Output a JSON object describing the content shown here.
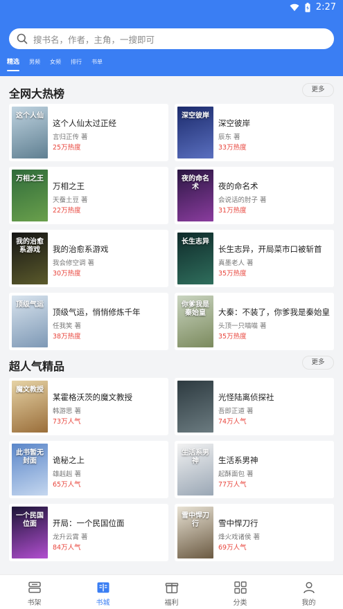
{
  "statusbar": {
    "time": "2:27",
    "icons": [
      "wifi-icon",
      "battery-charging-icon"
    ]
  },
  "search": {
    "placeholder": "搜书名，作者，主角，一搜即可"
  },
  "tabs": [
    {
      "label": "精选",
      "active": true
    },
    {
      "label": "男频"
    },
    {
      "label": "女频"
    },
    {
      "label": "排行"
    },
    {
      "label": "书单"
    }
  ],
  "sections": [
    {
      "title": "全网大热榜",
      "more": "更多",
      "books": [
        {
          "title": "这个人仙太过正经",
          "author": "言归正传 著",
          "stat": "25万热度",
          "cover_text": "这个人仙",
          "cover_colors": [
            "#bfd3e0",
            "#5f7f91"
          ]
        },
        {
          "title": "深空彼岸",
          "author": "辰东 著",
          "stat": "33万热度",
          "cover_text": "深空彼岸",
          "cover_colors": [
            "#1b2a6b",
            "#5a6fbf"
          ]
        },
        {
          "title": "万相之王",
          "author": "天蚕土豆 著",
          "stat": "22万热度",
          "cover_text": "万相之王",
          "cover_colors": [
            "#2f6b3a",
            "#6aa04c"
          ]
        },
        {
          "title": "夜的命名术",
          "author": "会说话的肘子 著",
          "stat": "31万热度",
          "cover_text": "夜的命名术",
          "cover_colors": [
            "#2a1642",
            "#8a3c9e"
          ]
        },
        {
          "title": "我的治愈系游戏",
          "author": "我会修空调 著",
          "stat": "30万热度",
          "cover_text": "我的治愈系游戏",
          "cover_colors": [
            "#151515",
            "#5b5a2b"
          ]
        },
        {
          "title": "长生志异，开局菜市口被斩首",
          "author": "真墨老人 著",
          "stat": "35万热度",
          "cover_text": "长生志异",
          "cover_colors": [
            "#0f2a2a",
            "#2f6e5c"
          ]
        },
        {
          "title": "顶级气运，悄悄修炼千年",
          "author": "任我笑 著",
          "stat": "38万热度",
          "cover_text": "顶级气运",
          "cover_colors": [
            "#d9e4ee",
            "#7d98b5"
          ]
        },
        {
          "title": "大秦：不装了，你爹我是秦始皇",
          "author": "头顶一只喵喵 著",
          "stat": "35万热度",
          "cover_text": "你爹我是秦始皇",
          "cover_colors": [
            "#c9d4c0",
            "#7b8a5d"
          ]
        }
      ]
    },
    {
      "title": "超人气精品",
      "more": "更多",
      "books": [
        {
          "title": "某霍格沃茨的魔文教授",
          "author": "韩游思 著",
          "stat": "73万人气",
          "cover_text": "魔文教授",
          "cover_colors": [
            "#e6d3a6",
            "#9a6e3a"
          ]
        },
        {
          "title": "光怪陆离侦探社",
          "author": "吾即正道 著",
          "stat": "74万人气",
          "cover_text": "",
          "cover_colors": [
            "#2d3a40",
            "#6b7b80"
          ]
        },
        {
          "title": "诡秘之上",
          "author": "雄赳赳 著",
          "stat": "65万人气",
          "cover_text": "此书暂无封面",
          "cover_colors": [
            "#5a86c9",
            "#c5d7ef"
          ]
        },
        {
          "title": "生活系男神",
          "author": "起酥面包 著",
          "stat": "77万人气",
          "cover_text": "生活系男神",
          "cover_colors": [
            "#f2f2f2",
            "#9aa7b5"
          ]
        },
        {
          "title": "开局：一个民国位面",
          "author": "龙升云霄 著",
          "stat": "84万人气",
          "cover_text": "一个民国位面",
          "cover_colors": [
            "#1b1436",
            "#b24fd0"
          ]
        },
        {
          "title": "雪中悍刀行",
          "author": "烽火戏诸侯 著",
          "stat": "69万人气",
          "cover_text": "雪中悍刀行",
          "cover_colors": [
            "#e8e2d4",
            "#6b5a42"
          ]
        }
      ]
    }
  ],
  "bottom_nav": [
    {
      "label": "书架",
      "icon": "bookshelf-icon"
    },
    {
      "label": "书城",
      "icon": "book-store-icon",
      "active": true
    },
    {
      "label": "福利",
      "icon": "gift-icon"
    },
    {
      "label": "分类",
      "icon": "category-grid-icon"
    },
    {
      "label": "我的",
      "icon": "profile-icon"
    }
  ],
  "colors": {
    "accent": "#3a7ef3",
    "stat_red": "#e8453c",
    "background": "#f3f4f6"
  }
}
